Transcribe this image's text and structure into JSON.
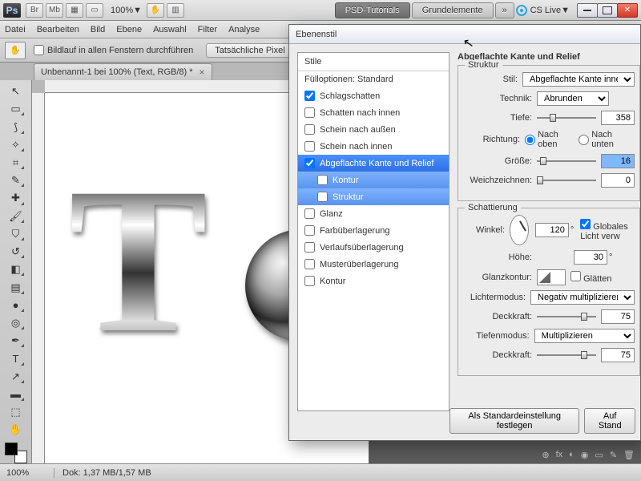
{
  "titlebar": {
    "ps": "Ps",
    "btn_br": "Br",
    "btn_mb": "Mb",
    "zoom": "100%",
    "tab1": "PSD-Tutorials",
    "tab2": "Grundelemente",
    "cslive": "CS Live"
  },
  "menu": [
    "Datei",
    "Bearbeiten",
    "Bild",
    "Ebene",
    "Auswahl",
    "Filter",
    "Analyse"
  ],
  "optbar": {
    "scroll_all": "Bildlauf in allen Fenstern durchführen",
    "actual_px": "Tatsächliche Pixel"
  },
  "doctab": {
    "title": "Unbenannt-1 bei 100% (Text, RGB/8) *"
  },
  "status": {
    "zoom": "100%",
    "doc": "Dok: 1,37 MB/1,57 MB"
  },
  "dialog": {
    "title": "Ebenenstil",
    "styles_hdr": "Stile",
    "fill_opts": "Fülloptionen: Standard",
    "items": {
      "drop_shadow": "Schlagschatten",
      "inner_shadow": "Schatten nach innen",
      "outer_glow": "Schein nach außen",
      "inner_glow": "Schein nach innen",
      "bevel": "Abgeflachte Kante und Relief",
      "contour_sub": "Kontur",
      "texture_sub": "Struktur",
      "satin": "Glanz",
      "color_overlay": "Farbüberlagerung",
      "grad_overlay": "Verlaufsüberlagerung",
      "pattern_overlay": "Musterüberlagerung",
      "stroke": "Kontur"
    },
    "panel_title": "Abgeflachte Kante und Relief",
    "struct_group": "Struktur",
    "shade_group": "Schattierung",
    "labels": {
      "stil": "Stil:",
      "technik": "Technik:",
      "tiefe": "Tiefe:",
      "richtung": "Richtung:",
      "nach_oben": "Nach oben",
      "nach_unten": "Nach unten",
      "groesse": "Größe:",
      "weich": "Weichzeichnen:",
      "winkel": "Winkel:",
      "global": "Globales Licht verw",
      "hoehe": "Höhe:",
      "glanzkontur": "Glanzkontur:",
      "glaetten": "Glätten",
      "lichtermodus": "Lichtermodus:",
      "deckkraft": "Deckkraft:",
      "tiefenmodus": "Tiefenmodus:"
    },
    "values": {
      "stil": "Abgeflachte Kante innen",
      "technik": "Abrunden",
      "tiefe": "358",
      "groesse": "16",
      "weich": "0",
      "winkel": "120",
      "hoehe": "30",
      "lichtermodus": "Negativ multiplizieren",
      "deck1": "75",
      "tiefenmodus": "Multiplizieren",
      "deck2": "75",
      "deg": "°"
    },
    "foot": {
      "default": "Als Standardeinstellung festlegen",
      "reset": "Auf Stand"
    }
  },
  "panel_icons": [
    "⊕",
    "fx",
    "◐",
    "◉",
    "▭",
    "✎",
    "🗑"
  ]
}
